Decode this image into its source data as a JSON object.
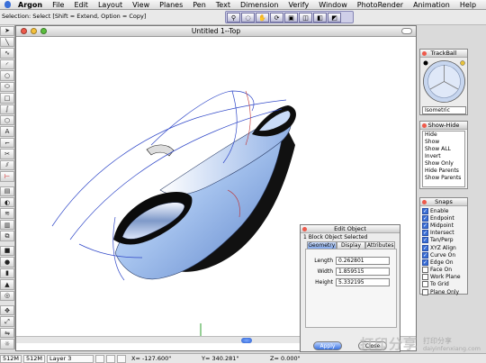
{
  "menubar": {
    "app": "Argon",
    "items": [
      "File",
      "Edit",
      "Layout",
      "View",
      "Planes",
      "Pen",
      "Text",
      "Dimension",
      "Verify",
      "Window",
      "PhotoRender",
      "Animation"
    ],
    "help": "Help"
  },
  "selection_status": "Selection: Select  [Shift = Extend, Option = Copy]",
  "window": {
    "title": "Untitled 1--Top"
  },
  "trackball": {
    "title": "TrackBall",
    "view": "Isometric"
  },
  "show_hide": {
    "title": "Show-Hide",
    "items": [
      "Hide",
      "Show",
      "Show ALL",
      "Invert",
      "Show Only",
      "Hide Parents",
      "Show Parents"
    ]
  },
  "snaps": {
    "title": "Snaps",
    "items": [
      {
        "label": "Enable",
        "checked": true
      },
      {
        "label": "Endpoint",
        "checked": true
      },
      {
        "label": "Midpoint",
        "checked": true
      },
      {
        "label": "Intersect",
        "checked": true
      },
      {
        "label": "Tan/Perp",
        "checked": true
      },
      {
        "label": "XYZ Align",
        "checked": true
      },
      {
        "label": "Curve On",
        "checked": true
      },
      {
        "label": "Edge On",
        "checked": true
      },
      {
        "label": "Face On",
        "checked": false
      },
      {
        "label": "Work Plane",
        "checked": false
      },
      {
        "label": "To Grid",
        "checked": false
      },
      {
        "label": "Plane Only",
        "checked": false
      }
    ]
  },
  "edit_object": {
    "title": "Edit Object",
    "subtitle": "1 Block Object Selected",
    "tabs": [
      "Geometry",
      "Display",
      "Attributes"
    ],
    "length_label": "Length",
    "length": "0.262801",
    "width_label": "Width",
    "width": "1.859515",
    "height_label": "Height",
    "height": "5.332195",
    "apply": "Apply",
    "close": "Close"
  },
  "statusbar": {
    "mem1": "512M",
    "mem2": "512M",
    "layer": "Layer 3",
    "x": "X= -127.600\"",
    "y": "Y= 340.281\"",
    "z": "Z= 0.000\""
  },
  "watermark": {
    "big": "打印分享",
    "line1": "打印分享",
    "line2": "daiyinfenxiang.com"
  },
  "colors": {
    "selection_accent": "#3b6fd6",
    "surface_blue": "#a9c6f0"
  }
}
